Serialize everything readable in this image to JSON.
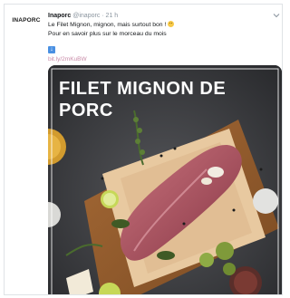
{
  "tweet": {
    "avatar_text": "INAPORC",
    "display_name": "Inaporc",
    "handle": "@inaporc",
    "time": "· 21 h",
    "line1": "Le Filet Mignon, mignon, mais surtout bon !",
    "line2": "Pour en savoir plus sur le morceau du mois",
    "link": "bit.ly/2mKuBW"
  },
  "media": {
    "title_line1": "FILET MIGNON DE",
    "title_line2": "PORC"
  },
  "icons": {
    "emoji": "smiling-face-icon",
    "arrow": "down-arrow-icon",
    "caret": "chevron-down-icon"
  },
  "colors": {
    "link": "#c98ba8",
    "meta": "#8a949e",
    "arrow_box": "#4a90e2"
  }
}
